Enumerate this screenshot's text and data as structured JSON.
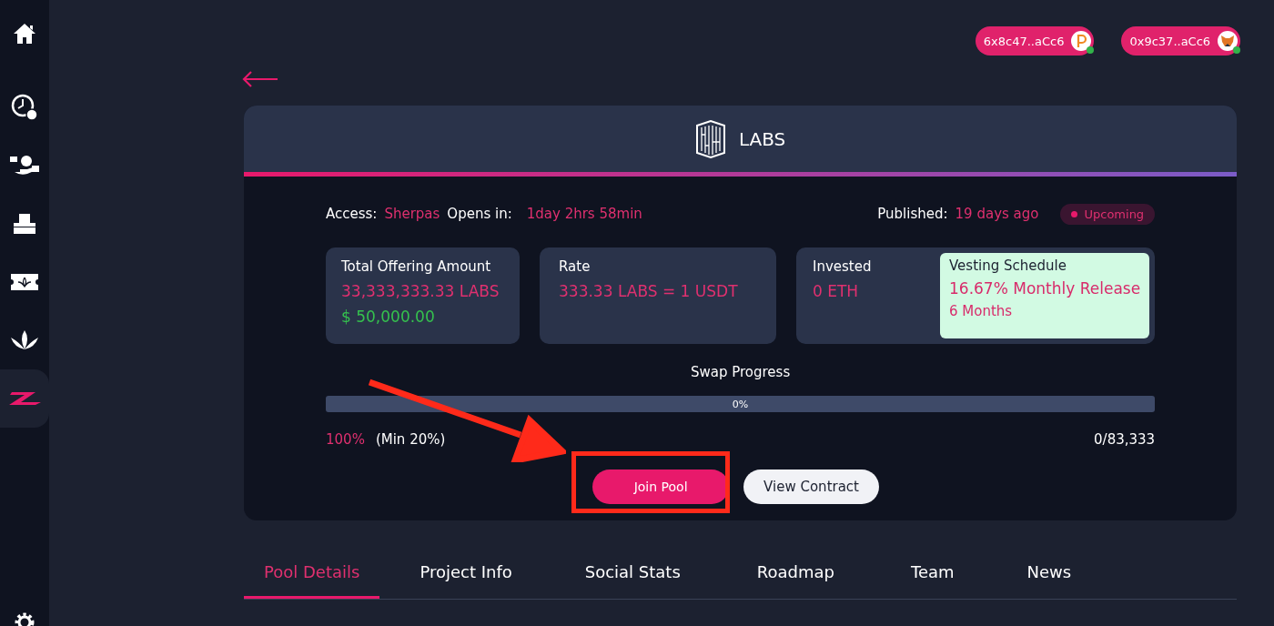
{
  "sidebar": {
    "items": [
      {
        "kind": "home",
        "selected": false
      },
      {
        "kind": "clock",
        "selected": false
      },
      {
        "kind": "hand",
        "selected": false
      },
      {
        "kind": "ballot",
        "selected": false
      },
      {
        "kind": "ticket",
        "selected": false
      },
      {
        "kind": "lotus",
        "selected": false
      },
      {
        "kind": "z",
        "selected": true
      }
    ],
    "footer": {
      "kind": "settings"
    }
  },
  "wallets": [
    {
      "address": "6x8c47..aCc6",
      "kind": "polkadot",
      "connected": true
    },
    {
      "address": "0x9c37..aCc6",
      "kind": "fox",
      "connected": true
    }
  ],
  "pool": {
    "name": "LABS",
    "access": {
      "label": "Access:",
      "value": "Sherpas"
    },
    "opens": {
      "label": "Opens in:",
      "value": "1day 2hrs 58min"
    },
    "published": {
      "label": "Published:",
      "value": "19 days ago"
    },
    "status": "Upcoming",
    "stats": [
      {
        "title": "Total Offering Amount",
        "value": "33,333,333.33 LABS",
        "sub": "$ 50,000.00"
      },
      {
        "title": "Rate",
        "value": "333.33 LABS = 1 USDT"
      },
      {
        "title": "Invested",
        "value": "0 ETH"
      }
    ],
    "vesting": {
      "title": "Vesting Schedule",
      "value": "16.67% Monthly Release",
      "sub": "6 Months"
    },
    "progress": {
      "title": "Swap Progress",
      "level": 0,
      "reading": "0%",
      "share": "100%",
      "min": "(Min 20%)",
      "count": "0/83,333"
    },
    "buttons": [
      {
        "label": "Join Pool",
        "kind": "primary"
      },
      {
        "label": "View Contract",
        "kind": "secondary"
      }
    ]
  },
  "tabs": [
    {
      "label": "Pool Details",
      "selected": true
    },
    {
      "label": "Project Info",
      "selected": false
    },
    {
      "label": "Social Stats",
      "selected": false
    },
    {
      "label": "Roadmap",
      "selected": false
    },
    {
      "label": "Team",
      "selected": false
    },
    {
      "label": "News",
      "selected": false
    }
  ]
}
